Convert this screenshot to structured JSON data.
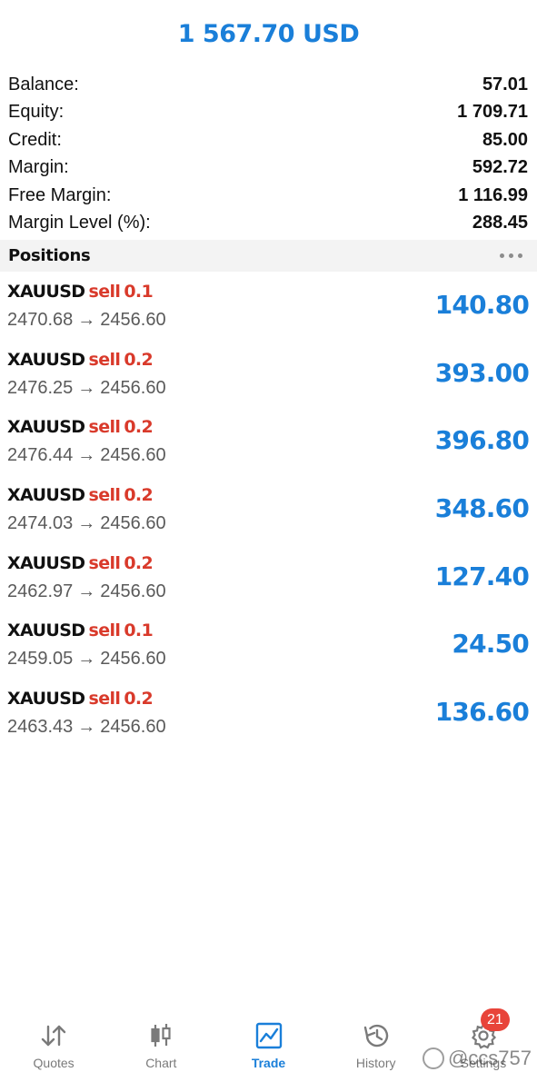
{
  "header": {
    "total_equity": "1 567.70 USD"
  },
  "summary": [
    {
      "label": "Balance:",
      "value": "57.01"
    },
    {
      "label": "Equity:",
      "value": "1 709.71"
    },
    {
      "label": "Credit:",
      "value": "85.00"
    },
    {
      "label": "Margin:",
      "value": "592.72"
    },
    {
      "label": "Free Margin:",
      "value": "1 116.99"
    },
    {
      "label": "Margin Level (%):",
      "value": "288.45"
    }
  ],
  "positions_section": {
    "title": "Positions",
    "more_icon": "more-horizontal-icon"
  },
  "positions": [
    {
      "symbol": "XAUUSD",
      "side": "sell",
      "volume": "0.1",
      "open_price": "2470.68",
      "arrow": "→",
      "current_price": "2456.60",
      "profit": "140.80"
    },
    {
      "symbol": "XAUUSD",
      "side": "sell",
      "volume": "0.2",
      "open_price": "2476.25",
      "arrow": "→",
      "current_price": "2456.60",
      "profit": "393.00"
    },
    {
      "symbol": "XAUUSD",
      "side": "sell",
      "volume": "0.2",
      "open_price": "2476.44",
      "arrow": "→",
      "current_price": "2456.60",
      "profit": "396.80"
    },
    {
      "symbol": "XAUUSD",
      "side": "sell",
      "volume": "0.2",
      "open_price": "2474.03",
      "arrow": "→",
      "current_price": "2456.60",
      "profit": "348.60"
    },
    {
      "symbol": "XAUUSD",
      "side": "sell",
      "volume": "0.2",
      "open_price": "2462.97",
      "arrow": "→",
      "current_price": "2456.60",
      "profit": "127.40"
    },
    {
      "symbol": "XAUUSD",
      "side": "sell",
      "volume": "0.1",
      "open_price": "2459.05",
      "arrow": "→",
      "current_price": "2456.60",
      "profit": "24.50"
    },
    {
      "symbol": "XAUUSD",
      "side": "sell",
      "volume": "0.2",
      "open_price": "2463.43",
      "arrow": "→",
      "current_price": "2456.60",
      "profit": "136.60"
    }
  ],
  "tabbar": {
    "tabs": [
      {
        "label": "Quotes",
        "icon": "quotes-arrows-icon",
        "active": false
      },
      {
        "label": "Chart",
        "icon": "candlestick-icon",
        "active": false
      },
      {
        "label": "Trade",
        "icon": "trade-chart-icon",
        "active": true
      },
      {
        "label": "History",
        "icon": "history-clock-icon",
        "active": false
      },
      {
        "label": "Settings",
        "icon": "gear-icon",
        "active": false,
        "badge": "21"
      }
    ]
  },
  "watermark": {
    "text": "@ccs757"
  },
  "colors": {
    "accent": "#1a7fd9",
    "sell": "#d93a2b",
    "badge": "#e8443a"
  }
}
